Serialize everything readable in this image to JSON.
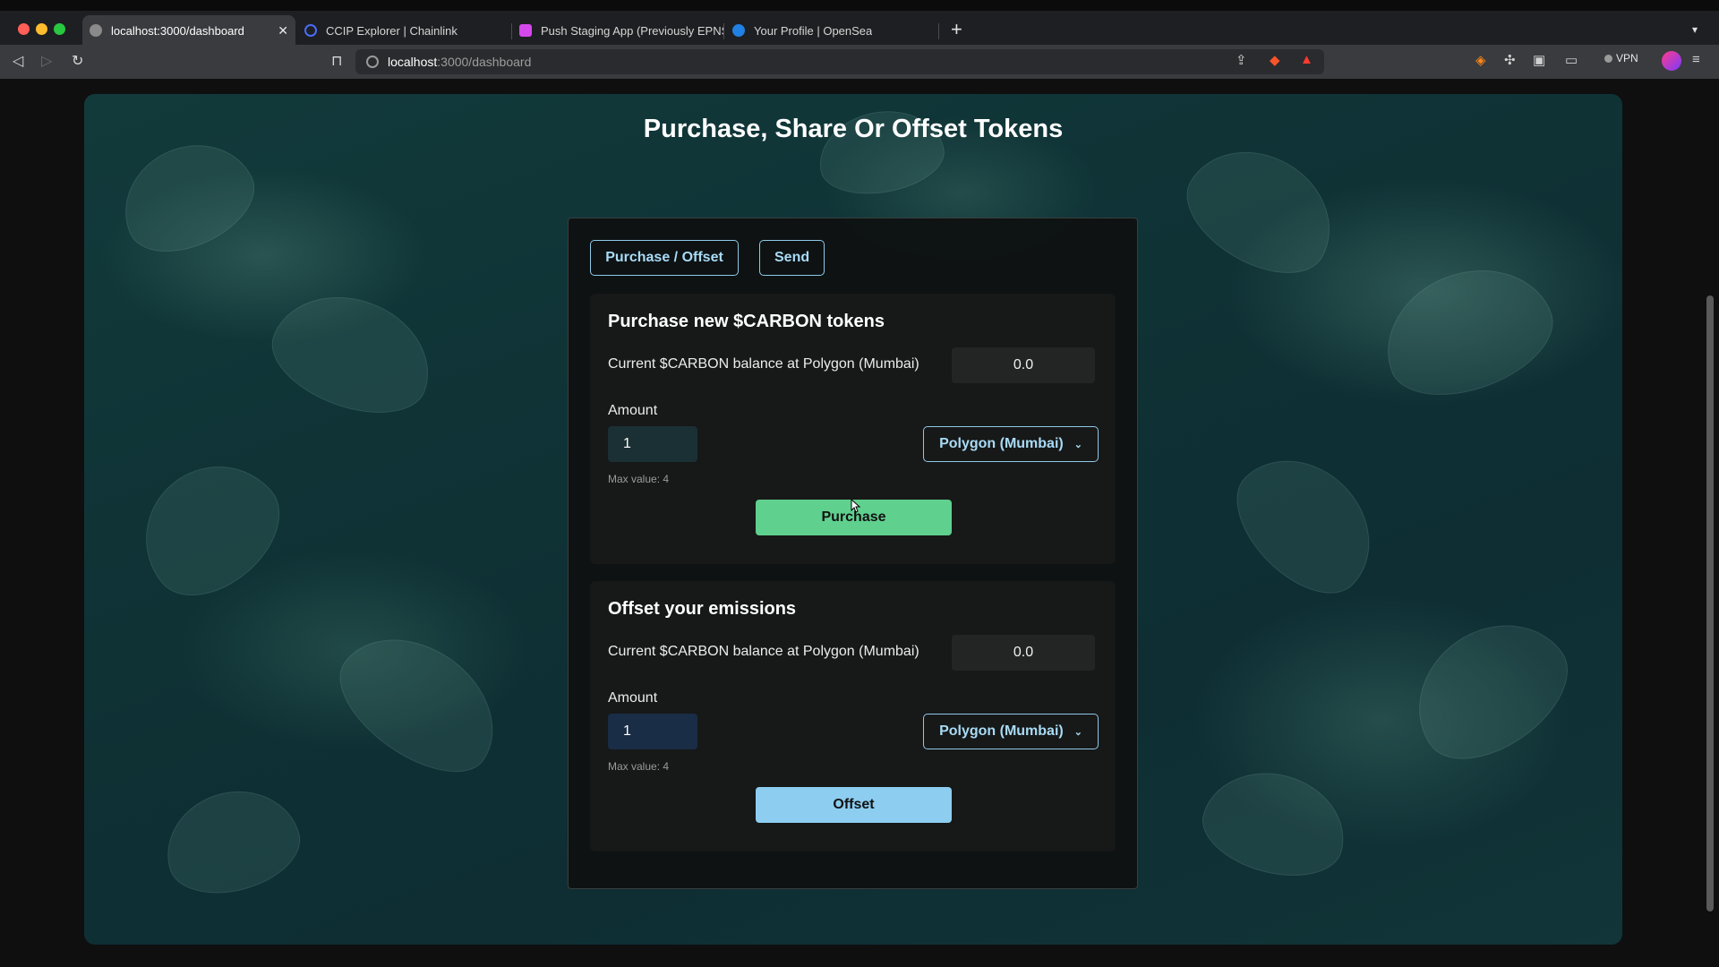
{
  "browser": {
    "tabs": [
      {
        "label": "localhost:3000/dashboard",
        "active": true,
        "icon": "globe-icon"
      },
      {
        "label": "CCIP Explorer | Chainlink",
        "active": false,
        "icon": "chainlink-icon"
      },
      {
        "label": "Push Staging App (Previously EPNS",
        "active": false,
        "icon": "push-icon"
      },
      {
        "label": "Your Profile | OpenSea",
        "active": false,
        "icon": "opensea-icon"
      }
    ],
    "address": {
      "host": "localhost",
      "path": ":3000/dashboard"
    },
    "vpn_label": "VPN"
  },
  "page": {
    "title": "Purchase, Share Or Offset Tokens",
    "tabs": {
      "purchase_offset": "Purchase / Offset",
      "send": "Send"
    },
    "purchase": {
      "heading": "Purchase new $CARBON tokens",
      "balance_label": "Current $CARBON balance at Polygon (Mumbai)",
      "balance_value": "0.0",
      "amount_label": "Amount",
      "amount_value": "1",
      "network": "Polygon (Mumbai)",
      "max_text": "Max value: 4",
      "button": "Purchase"
    },
    "offset": {
      "heading": "Offset your emissions",
      "balance_label": "Current $CARBON balance at Polygon (Mumbai)",
      "balance_value": "0.0",
      "amount_label": "Amount",
      "amount_value": "1",
      "network": "Polygon (Mumbai)",
      "max_text": "Max value: 4",
      "button": "Offset"
    }
  },
  "colors": {
    "accent_outline": "#8fc9e8",
    "purchase_button": "#5fd08e",
    "offset_button": "#8ccdf0",
    "background_teal": "#0f3235"
  }
}
